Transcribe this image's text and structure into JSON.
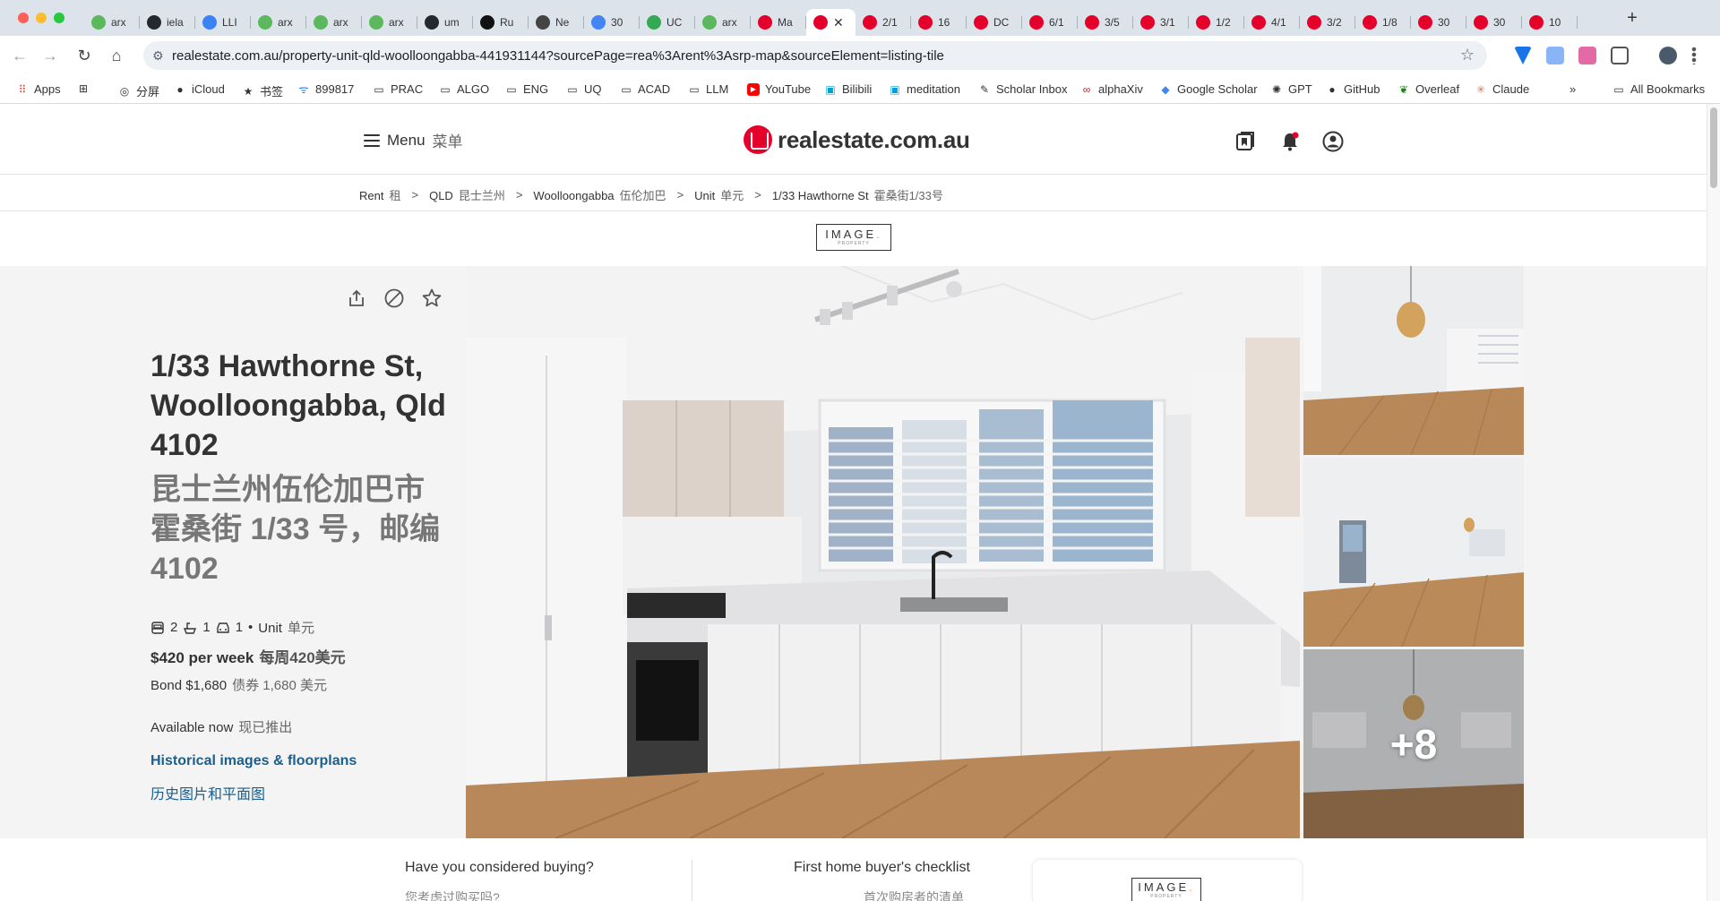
{
  "browser": {
    "tabs": [
      {
        "text": "arx",
        "color": "#5cb85c"
      },
      {
        "text": "iela",
        "color": "#24292f"
      },
      {
        "text": "LLI",
        "color": "#3b82f6"
      },
      {
        "text": "arx",
        "color": "#5cb85c"
      },
      {
        "text": "arx",
        "color": "#5cb85c"
      },
      {
        "text": "arx",
        "color": "#5cb85c"
      },
      {
        "text": "um",
        "color": "#24292f"
      },
      {
        "text": "Ru",
        "color": "#111111"
      },
      {
        "text": "Ne",
        "color": "#444444"
      },
      {
        "text": "30",
        "color": "#4285f4"
      },
      {
        "text": "UC",
        "color": "#34a853"
      },
      {
        "text": "arx",
        "color": "#5cb85c"
      },
      {
        "text": "Ma",
        "color": "#e4002b"
      },
      {
        "text": "",
        "color": "#e4002b",
        "active": true
      },
      {
        "text": "2/1",
        "color": "#e4002b"
      },
      {
        "text": "16",
        "color": "#e4002b"
      },
      {
        "text": "DC",
        "color": "#e4002b"
      },
      {
        "text": "6/1",
        "color": "#e4002b"
      },
      {
        "text": "3/5",
        "color": "#e4002b"
      },
      {
        "text": "3/1",
        "color": "#e4002b"
      },
      {
        "text": "1/2",
        "color": "#e4002b"
      },
      {
        "text": "4/1",
        "color": "#e4002b"
      },
      {
        "text": "3/2",
        "color": "#e4002b"
      },
      {
        "text": "1/8",
        "color": "#e4002b"
      },
      {
        "text": "30",
        "color": "#e4002b"
      },
      {
        "text": "30",
        "color": "#e4002b"
      },
      {
        "text": "10",
        "color": "#e4002b"
      }
    ],
    "new_tab": "+",
    "url": "realestate.com.au/property-unit-qld-woolloongabba-441931144?sourcePage=rea%3Arent%3Asrp-map&sourceElement=listing-tile"
  },
  "bookmarks": {
    "items": [
      "Apps",
      "分屏",
      "iCloud",
      "书签",
      "899817",
      "PRAC",
      "ALGO",
      "ENG",
      "UQ",
      "ACAD",
      "LLM",
      "YouTube",
      "Bilibili",
      "meditation",
      "Scholar Inbox",
      "alphaXiv",
      "Google Scholar",
      "GPT",
      "GitHub",
      "Overleaf",
      "Claude"
    ],
    "overflow": "»",
    "all": "All Bookmarks"
  },
  "header": {
    "menu_label": "Menu",
    "menu_zh": "菜单",
    "brand": "realestate.com.au"
  },
  "breadcrumb": [
    {
      "en": "Rent",
      "zh": "租"
    },
    {
      "en": "QLD",
      "zh": "昆士兰州"
    },
    {
      "en": "Woolloongabba",
      "zh": "伍伦加巴"
    },
    {
      "en": "Unit",
      "zh": "单元"
    },
    {
      "en": "1/33 Hawthorne St",
      "zh": "霍桑街1/33号"
    }
  ],
  "agency": {
    "name": "IMAGE",
    "dot": ".",
    "sub": "PROPERTY"
  },
  "listing": {
    "title_en": "1/33 Hawthorne St, Woolloongabba, Qld 4102",
    "title_zh": "昆士兰州伍伦加巴市霍桑街 1/33 号，邮编 4102",
    "bedrooms": "2",
    "bathrooms": "1",
    "parking": "1",
    "bullet": "•",
    "type": "Unit",
    "type_zh": "单元",
    "price": "$420 per week",
    "price_zh": "每周420美元",
    "bond": "Bond $1,680",
    "bond_zh": "债券 1,680 美元",
    "available": "Available now",
    "available_zh": "现已推出",
    "historical_link": "Historical images & floorplans",
    "historical_link_zh": "历史图片和平面图"
  },
  "gallery": {
    "more_count": "+8"
  },
  "promo": {
    "buying_title": "Have you considered buying?",
    "buying_sub": "您考虑过购买吗?",
    "checklist_title": "First home buyer's checklist",
    "checklist_sub": "首次购房者的清单"
  }
}
